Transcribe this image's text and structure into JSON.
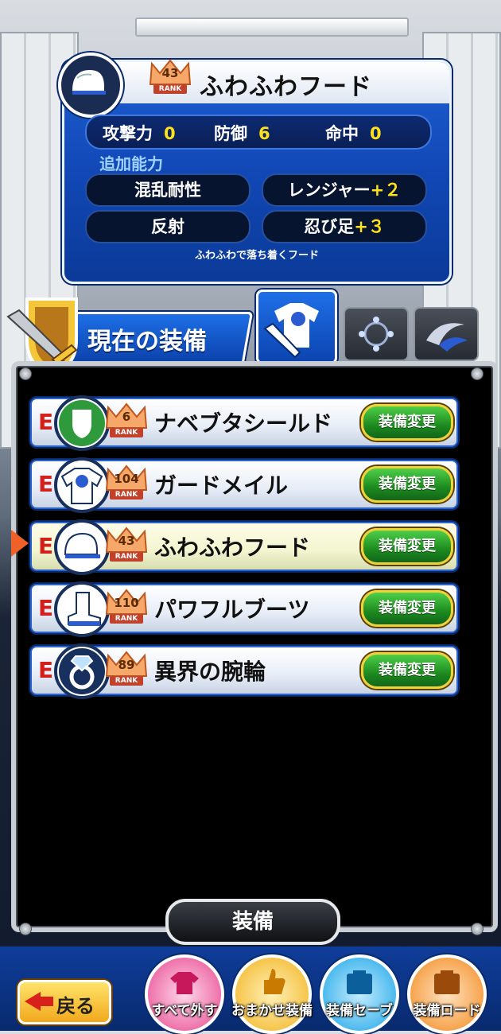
{
  "item_detail": {
    "rank": "43",
    "rank_label": "RANK",
    "name": "ふわふわフード",
    "stats": [
      {
        "label": "攻撃力",
        "value": "0"
      },
      {
        "label": "防御",
        "value": "6"
      },
      {
        "label": "命中",
        "value": "0"
      }
    ],
    "abilities_title": "追加能力",
    "abilities": [
      {
        "name": "混乱耐性",
        "bonus": ""
      },
      {
        "name": "レンジャー",
        "bonus": "+２"
      },
      {
        "name": "反射",
        "bonus": ""
      },
      {
        "name": "忍び足",
        "bonus": "+３"
      }
    ],
    "description": "ふわふわで落ち着くフード"
  },
  "section": {
    "title": "現在の装備",
    "tabs": [
      "armor-tab-icon",
      "accessory-tab-icon",
      "special-tab-icon"
    ]
  },
  "equipment": [
    {
      "badge": "E",
      "icon": "shield-icon",
      "rank": "6",
      "rank_label": "RANK",
      "name": "ナベブタシールド",
      "button": "装備変更",
      "selected": false
    },
    {
      "badge": "E",
      "icon": "armor-shirt-icon",
      "rank": "104",
      "rank_label": "RANK",
      "name": "ガードメイル",
      "button": "装備変更",
      "selected": false
    },
    {
      "badge": "E",
      "icon": "helmet-icon",
      "rank": "43",
      "rank_label": "RANK",
      "name": "ふわふわフード",
      "button": "装備変更",
      "selected": true
    },
    {
      "badge": "E",
      "icon": "boots-icon",
      "rank": "110",
      "rank_label": "RANK",
      "name": "パワフルブーツ",
      "button": "装備変更",
      "selected": false
    },
    {
      "badge": "E",
      "icon": "ring-icon",
      "rank": "89",
      "rank_label": "RANK",
      "name": "異界の腕輪",
      "button": "装備変更",
      "selected": false
    }
  ],
  "equip_button": "装備",
  "bottom": {
    "back": "戻る",
    "actions": [
      {
        "label": "すべて外す",
        "color": "#e7478f"
      },
      {
        "label": "おまかせ装備",
        "color": "#f2b21d"
      },
      {
        "label": "装備セーブ",
        "color": "#1aa5e6"
      },
      {
        "label": "装備ロード",
        "color": "#f28a1d"
      }
    ]
  },
  "colors": {
    "panel_blue": "#1148b6",
    "stat_yellow": "#ffe11a",
    "badge_red": "#d4201b",
    "button_green": "#1d8a1e"
  }
}
